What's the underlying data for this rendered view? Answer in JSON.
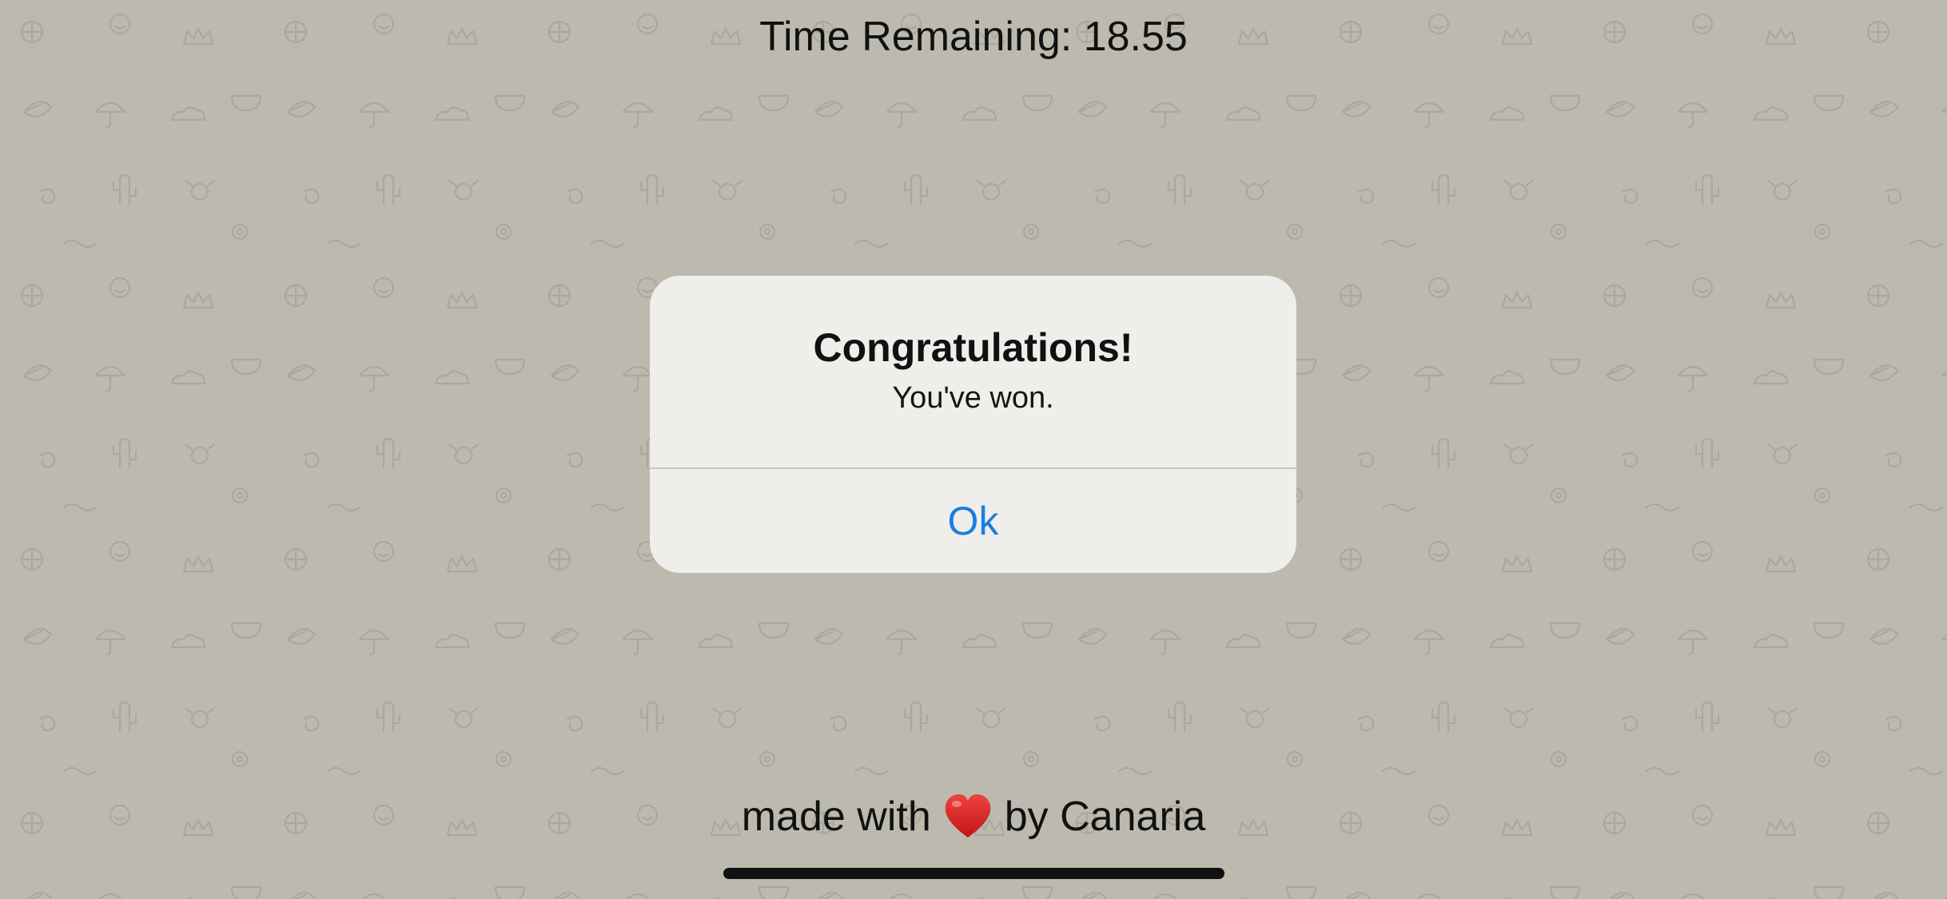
{
  "timer": {
    "text": "Time Remaining: 18.55"
  },
  "alert": {
    "title": "Congratulations!",
    "message": "You've won.",
    "button_label": "Ok",
    "button_color": "#1a7fe0"
  },
  "footer": {
    "prefix": "made with",
    "icon": "heart-icon",
    "suffix": "by Canaria"
  },
  "colors": {
    "background": "#bcbaae",
    "alert_background": "#efeeeb",
    "heart": "#d7191c"
  }
}
